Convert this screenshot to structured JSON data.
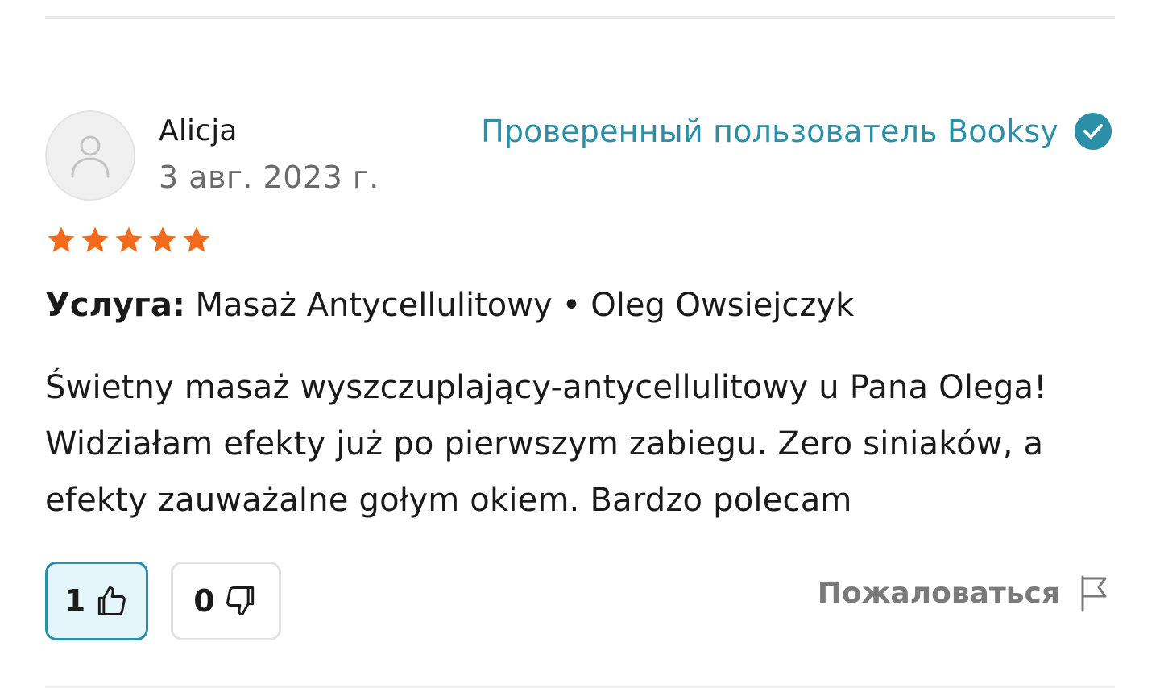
{
  "review": {
    "reviewer_name": "Alicja",
    "date": "3 авг. 2023 г.",
    "verified_label": "Проверенный пользователь Booksy",
    "rating": 5,
    "star_color": "#f26b1d",
    "service_label": "Услуга:",
    "service_name": "Masaż Antycellulitowy",
    "separator": "•",
    "staff_name": "Oleg Owsiejczyk",
    "text": "Świetny masaż wyszczuplający-antycellulitowy u Pana Olega! Widziałam efekty już po pierwszym zabiegu. Zero siniaków, a efekty zauważalne gołym okiem. Bardzo polecam"
  },
  "votes": {
    "helpful_count": "1",
    "unhelpful_count": "0"
  },
  "report": {
    "label": "Пожаловаться"
  },
  "icons": {
    "avatar": "user-icon",
    "verified": "check-circle-icon",
    "helpful": "thumbs-up-icon",
    "unhelpful": "thumbs-down-icon",
    "report": "flag-icon",
    "rating": "star-icon"
  },
  "colors": {
    "accent": "#2b8fa8",
    "helpful_bg": "#e3f5f8",
    "muted_text": "#6b6b6b"
  }
}
